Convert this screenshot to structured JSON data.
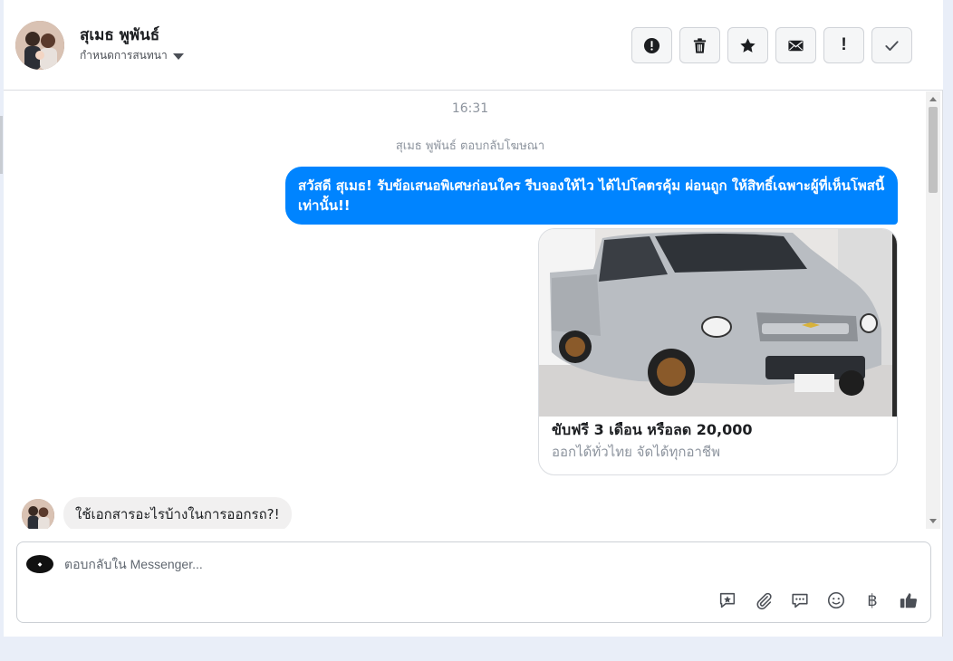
{
  "header": {
    "contact_name": "สุเมธ พูพันธ์",
    "assign_label": "กำหนดการสนทนา",
    "actions": [
      {
        "name": "report-spam",
        "icon": "alert-circle-icon"
      },
      {
        "name": "delete",
        "icon": "trash-icon"
      },
      {
        "name": "star",
        "icon": "star-icon"
      },
      {
        "name": "mark-unread",
        "icon": "envelope-icon"
      },
      {
        "name": "mark-important",
        "icon": "exclamation-icon",
        "glyph": "!"
      },
      {
        "name": "mark-done",
        "icon": "checkmark-icon"
      }
    ]
  },
  "conversation": {
    "timestamp": "16:31",
    "reply_note": "สุเมธ พูพันธ์ ตอบกลับโฆษณา",
    "outgoing_message": "สวัสดี สุเมธ! รับข้อเสนอพิเศษก่อนใคร รีบจองให้ไว ได้ไปโคตรคุ้ม ผ่อนถูก ให้สิทธิ์เฉพาะผู้ที่เห็นโพสนี้เท่านั้น!!",
    "ad_card": {
      "title": "ขับฟรี 3 เดือน หรือลด 20,000",
      "subtitle": "ออกได้ทั่วไทย จัดได้ทุกอาชีพ"
    },
    "incoming_message": "ใช้เอกสารอะไรบ้างในการออกรถ?!"
  },
  "composer": {
    "placeholder": "ตอบกลับใน Messenger...",
    "tools": [
      "saved-reply-icon",
      "attachment-icon",
      "chat-bubble-icon",
      "emoji-icon",
      "baht-icon",
      "thumbs-up-icon"
    ],
    "baht_glyph": "฿"
  },
  "colors": {
    "outgoing_bubble": "#0084ff",
    "incoming_bubble": "#f1f0f0",
    "page_background": "#e9eef8"
  }
}
